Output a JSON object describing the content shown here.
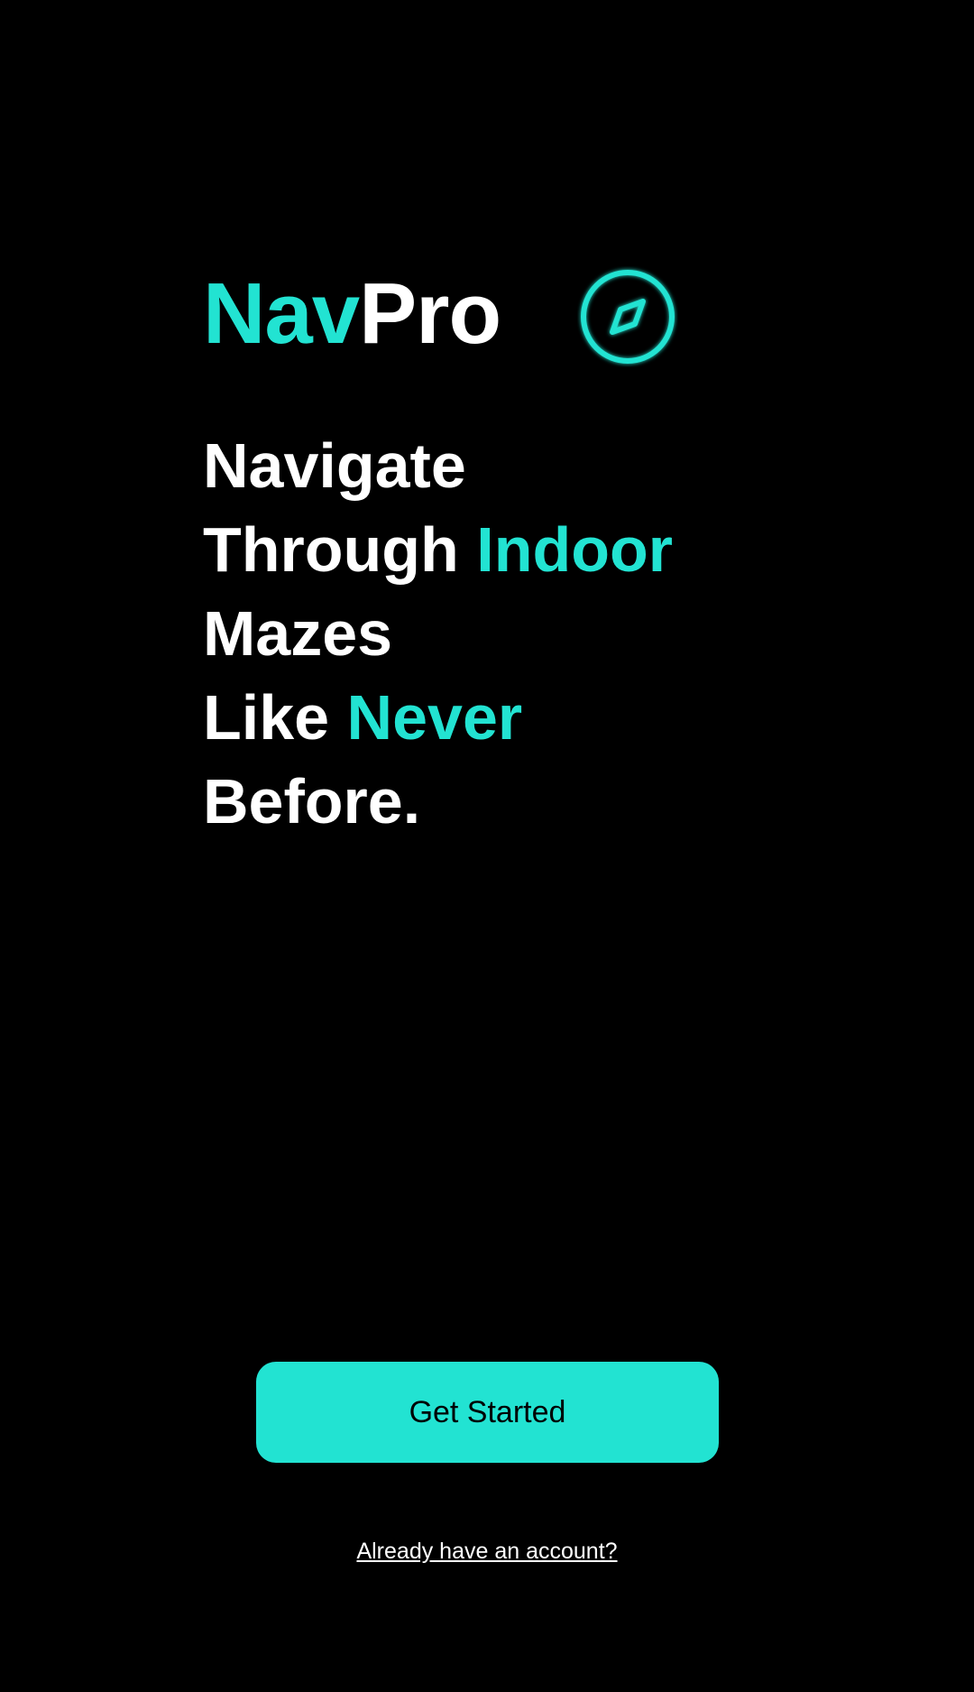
{
  "brand": {
    "part1": "Nav",
    "part2": "Pro"
  },
  "brand_icon": "compass-icon",
  "headline": {
    "line1": "Navigate",
    "line2_a": "Through ",
    "line2_b": "Indoor",
    "line3": "Mazes",
    "line4_a": "Like ",
    "line4_b": "Never",
    "line5": "Before."
  },
  "buttons": {
    "get_started": "Get Started"
  },
  "links": {
    "sign_in": "Already have an account?"
  },
  "colors": {
    "background": "#000000",
    "accent": "#22e3d2",
    "text": "#ffffff",
    "button_text": "#000000"
  }
}
